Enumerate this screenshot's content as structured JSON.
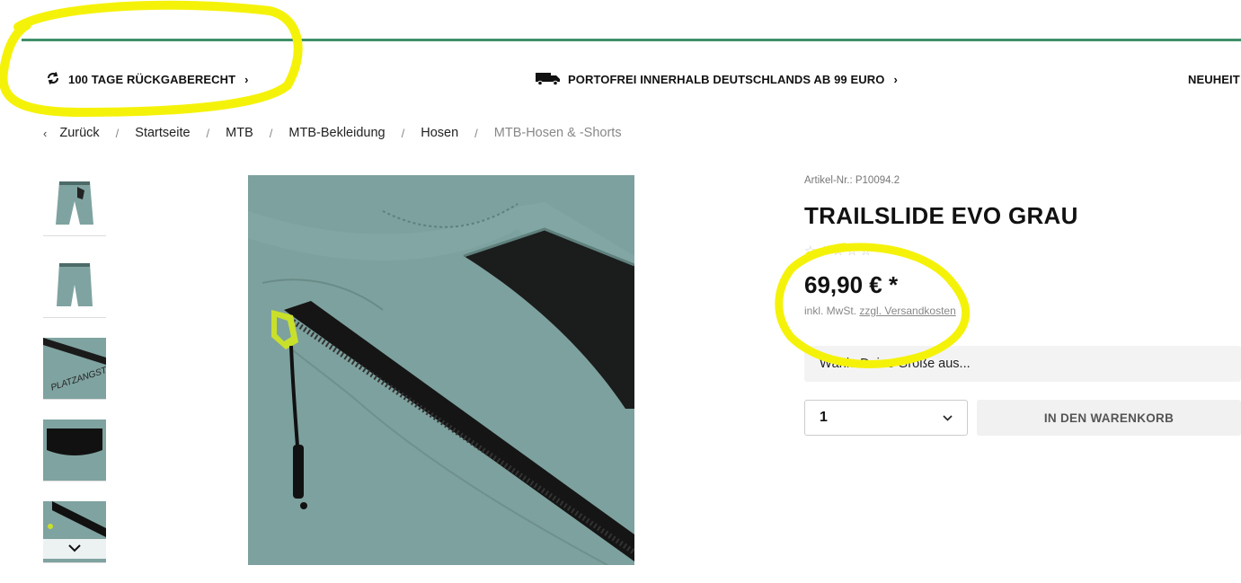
{
  "benefits": [
    {
      "label": "100 TAGE RÜCKGABERECHT",
      "icon": "refresh-icon"
    },
    {
      "label": "PORTOFREI INNERHALB DEUTSCHLANDS AB 99 EURO",
      "icon": "truck-icon"
    },
    {
      "label": "NEUHEIT"
    }
  ],
  "breadcrumb": {
    "back": "Zurück",
    "items": [
      "Startseite",
      "MTB",
      "MTB-Bekleidung",
      "Hosen",
      "MTB-Hosen & -Shorts"
    ]
  },
  "product": {
    "sku": "Artikel-Nr.: P10094.2",
    "title": "TRAILSLIDE EVO GRAU",
    "rating": 0,
    "price": "69,90 € *",
    "tax_prefix": "inkl. MwSt.",
    "tax_link": "zzgl. Versandkosten",
    "size_placeholder": "Wähle Deine Größe aus...",
    "quantity": "1",
    "cart_button": "IN DEN WARENKORB"
  },
  "colors": {
    "accent_line": "#3f8f6a",
    "fabric": "#7fa3a0",
    "zipper_pull": "#c9e02a",
    "highlight": "#f5f20a"
  }
}
